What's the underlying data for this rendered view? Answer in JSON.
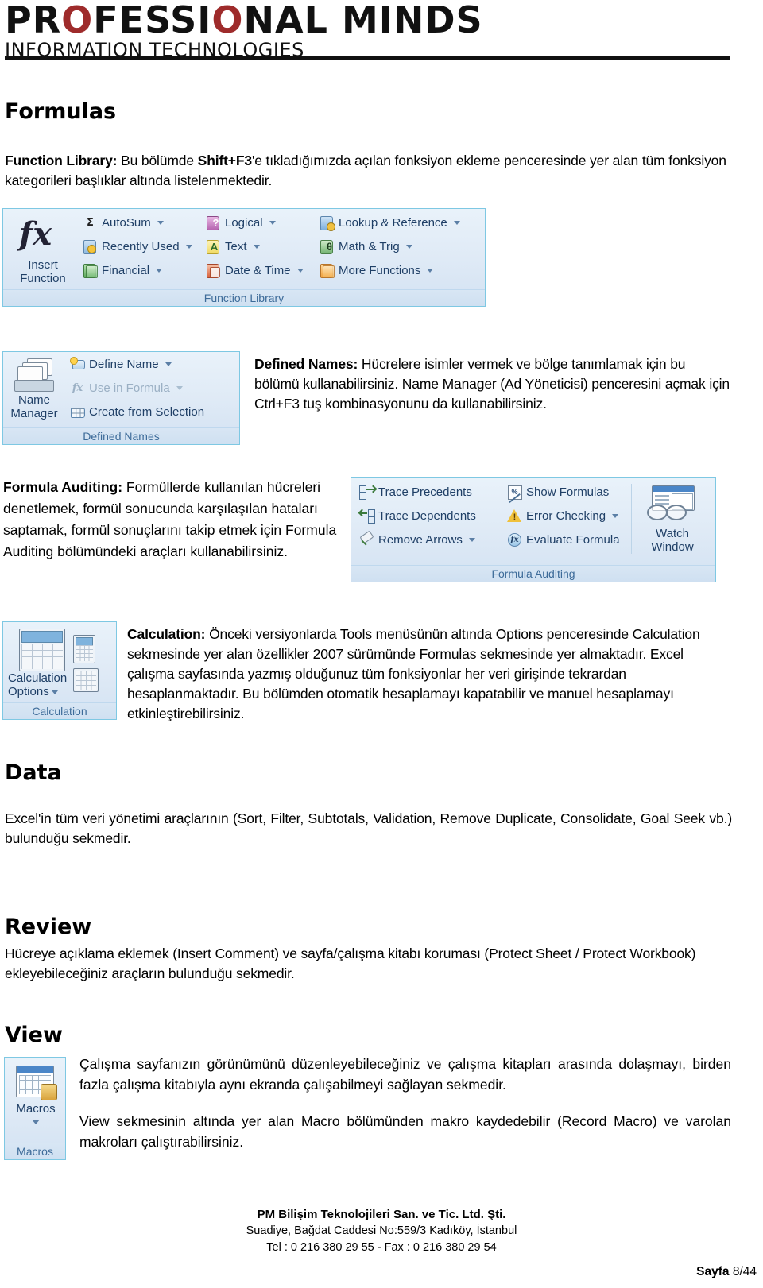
{
  "header": {
    "logo_main_part1": "PR",
    "logo_main_o1": "O",
    "logo_main_part2": "FESSI",
    "logo_main_o2": "O",
    "logo_main_part3": "NAL MINDS",
    "logo_sub": "INFORMATION TECHNOLOGIES"
  },
  "sections": {
    "formulas": {
      "title": "Formulas",
      "function_library_intro_bold": "Function Library:",
      "function_library_intro_1": " Bu bölümde ",
      "function_library_intro_bold2": "Shift+F3",
      "function_library_intro_2": "'e tıkladığımızda açılan fonksiyon ekleme penceresinde yer alan tüm fonksiyon kategorileri başlıklar altında listelenmektedir."
    },
    "data": {
      "title": "Data",
      "body": "Excel'in tüm veri yönetimi araçlarının (Sort, Filter, Subtotals, Validation, Remove Duplicate, Consolidate, Goal Seek vb.) bulunduğu sekmedir."
    },
    "review": {
      "title": "Review",
      "body": "Hücreye açıklama eklemek (Insert Comment) ve sayfa/çalışma kitabı koruması (Protect Sheet / Protect Workbook) ekleyebileceğiniz araçların bulunduğu sekmedir."
    },
    "view": {
      "title": "View",
      "body1": "Çalışma sayfanızın görünümünü düzenleyebileceğiniz ve çalışma kitapları arasında dolaşmayı, birden fazla çalışma kitabıyla aynı ekranda çalışabilmeyi sağlayan sekmedir.",
      "body2": "View sekmesinin altında yer alan Macro bölümünden makro kaydedebilir (Record Macro) ve varolan makroları çalıştırabilirsiniz."
    }
  },
  "descriptions": {
    "defined_names_bold": "Defined Names:",
    "defined_names_body": " Hücrelere isimler vermek ve bölge tanımlamak için bu bölümü kullanabilirsiniz. Name Manager (Ad Yöneticisi) penceresini açmak için Ctrl+F3 tuş kombinasyonunu da kullanabilirsiniz.",
    "formula_auditing_bold": "Formula Auditing:",
    "formula_auditing_body": " Formüllerde kullanılan hücreleri denetlemek, formül sonucunda karşılaşılan hataları saptamak, formül sonuçlarını takip etmek için Formula Auditing bölümündeki araçları kullanabilirsiniz.",
    "calculation_bold": "Calculation:",
    "calculation_body": " Önceki versiyonlarda Tools menüsünün altında Options penceresinde Calculation sekmesinde yer alan özellikler 2007 sürümünde Formulas sekmesinde yer almaktadır. Excel çalışma sayfasında yazmış olduğunuz tüm fonksiyonlar her veri girişinde tekrardan hesaplanmaktadır. Bu bölümden otomatik hesaplamayı kapatabilir ve manuel hesaplamayı etkinleştirebilirsiniz."
  },
  "ribbons": {
    "function_library": {
      "group_label": "Function Library",
      "insert_function_line1": "Insert",
      "insert_function_line2": "Function",
      "items": [
        {
          "label": "AutoSum",
          "icon": "sigma-icon",
          "dropdown": true
        },
        {
          "label": "Recently Used",
          "icon": "recently-used-icon",
          "dropdown": true
        },
        {
          "label": "Financial",
          "icon": "financial-icon",
          "dropdown": true
        },
        {
          "label": "Logical",
          "icon": "logical-icon",
          "dropdown": true
        },
        {
          "label": "Text",
          "icon": "text-icon",
          "dropdown": true
        },
        {
          "label": "Date & Time",
          "icon": "date-time-icon",
          "dropdown": true
        },
        {
          "label": "Lookup & Reference",
          "icon": "lookup-reference-icon",
          "dropdown": true
        },
        {
          "label": "Math & Trig",
          "icon": "math-trig-icon",
          "dropdown": true
        },
        {
          "label": "More Functions",
          "icon": "more-functions-icon",
          "dropdown": true
        }
      ]
    },
    "defined_names": {
      "group_label": "Defined Names",
      "name_manager_line1": "Name",
      "name_manager_line2": "Manager",
      "items": [
        {
          "label": "Define Name",
          "icon": "define-name-icon",
          "dropdown": true,
          "disabled": false
        },
        {
          "label": "Use in Formula",
          "icon": "use-in-formula-icon",
          "dropdown": true,
          "disabled": true
        },
        {
          "label": "Create from Selection",
          "icon": "create-from-selection-icon",
          "dropdown": false,
          "disabled": false
        }
      ]
    },
    "formula_auditing": {
      "group_label": "Formula Auditing",
      "watch_window_line1": "Watch",
      "watch_window_line2": "Window",
      "items": [
        {
          "label": "Trace Precedents",
          "icon": "trace-precedents-icon",
          "dropdown": false
        },
        {
          "label": "Trace Dependents",
          "icon": "trace-dependents-icon",
          "dropdown": false
        },
        {
          "label": "Remove Arrows",
          "icon": "remove-arrows-icon",
          "dropdown": true
        },
        {
          "label": "Show Formulas",
          "icon": "show-formulas-icon",
          "dropdown": false
        },
        {
          "label": "Error Checking",
          "icon": "error-checking-icon",
          "dropdown": true
        },
        {
          "label": "Evaluate Formula",
          "icon": "evaluate-formula-icon",
          "dropdown": false
        }
      ]
    },
    "calculation": {
      "group_label": "Calculation",
      "options_line1": "Calculation",
      "options_line2": "Options"
    },
    "macros": {
      "group_label": "Macros",
      "button_label": "Macros"
    }
  },
  "footer": {
    "company": "PM Bilişim Teknolojileri San. ve Tic. Ltd. Şti.",
    "address": "Suadiye, Bağdat Caddesi No:559/3 Kadıköy, İstanbul",
    "contact": "Tel : 0 216 380 29 55  -  Fax : 0 216 380 29 54",
    "page_label": "Sayfa",
    "page_value": " 8/44"
  },
  "colors": {
    "logo_red": "#9e2b2b",
    "ribbon_border": "#7ec8e3",
    "ribbon_text": "#1f3f66"
  }
}
